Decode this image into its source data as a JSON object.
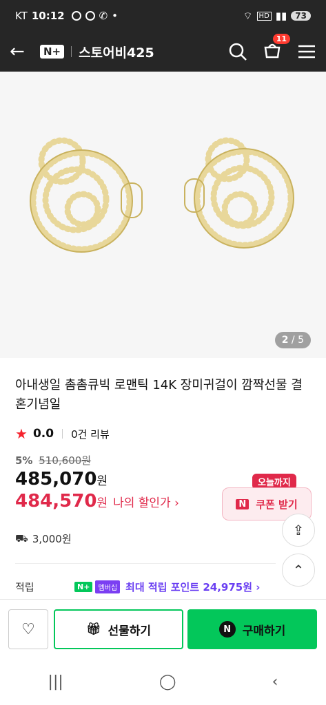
{
  "status_bar": {
    "carrier": "KT",
    "time": "10:12",
    "battery": "73"
  },
  "app_bar": {
    "brand_badge": "N+",
    "store_name": "스토어비425",
    "cart_count": "11"
  },
  "gallery": {
    "current": "2",
    "separator": " / ",
    "total": "5"
  },
  "product": {
    "title": "아내생일 촘촘큐빅 로맨틱 14K 장미귀걸이 깜짝선물 결혼기념일",
    "rating": "0.0",
    "reviews": "0건 리뷰",
    "discount_pct": "5%",
    "original_price": "510,600원",
    "price": "485,070",
    "price_unit": "원",
    "my_price": "484,570",
    "my_price_unit": "원",
    "my_price_label": "나의 할인가 ›",
    "shipping": "3,000원"
  },
  "coupon": {
    "tag": "오늘까지",
    "nbox": "N",
    "label": "쿠폰 받기"
  },
  "points": {
    "label": "적립",
    "badge": "N+",
    "member": "멤버십",
    "text": "최대 적립 포인트 24,975원 ›"
  },
  "actions": {
    "gift": "선물하기",
    "buy": "구매하기",
    "buy_logo": "N"
  }
}
